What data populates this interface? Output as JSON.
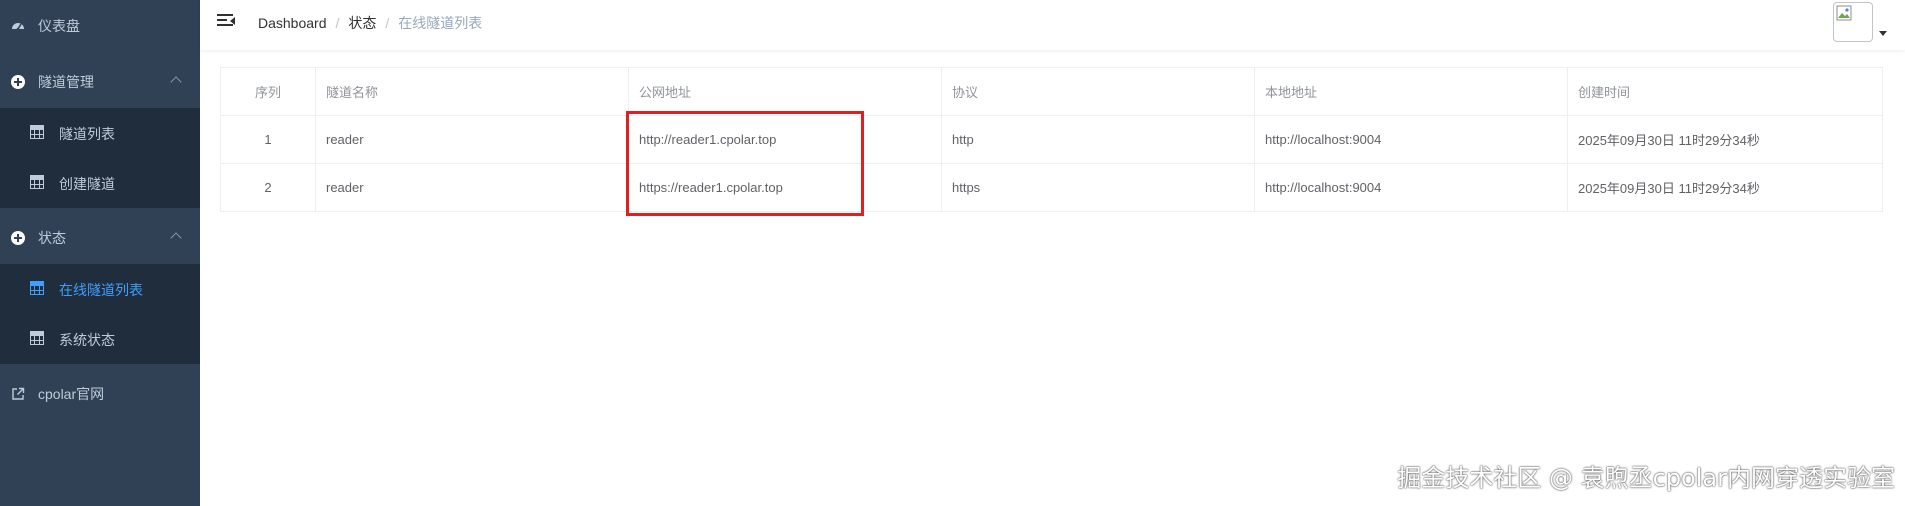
{
  "sidebar": {
    "dashboard": "仪表盘",
    "tunnel_mgmt": "隧道管理",
    "tunnel_list": "隧道列表",
    "create_tunnel": "创建隧道",
    "status": "状态",
    "online_tunnels": "在线隧道列表",
    "system_status": "系统状态",
    "cpolar_site": "cpolar官网"
  },
  "breadcrumb": {
    "home": "Dashboard",
    "sep1": "/",
    "level2": "状态",
    "sep2": "/",
    "current": "在线隧道列表"
  },
  "table": {
    "headers": [
      "序列",
      "隧道名称",
      "公网地址",
      "协议",
      "本地地址",
      "创建时间"
    ],
    "rows": [
      [
        "1",
        "reader",
        "http://reader1.cpolar.top",
        "http",
        "http://localhost:9004",
        "2025年09月30日 11时29分34秒"
      ],
      [
        "2",
        "reader",
        "https://reader1.cpolar.top",
        "https",
        "http://localhost:9004",
        "2025年09月30日 11时29分34秒"
      ]
    ]
  },
  "watermark": "掘金技术社区 @ 袁煦丞cpolar内网穿透实验室",
  "colors": {
    "sidebar_bg": "#304156",
    "submenu_bg": "#1f2d3d",
    "active": "#409eff",
    "highlight": "#e02020"
  },
  "icons": [
    "dashboard-icon",
    "plus-circle-icon",
    "grid-icon",
    "external-link-icon",
    "hamburger-icon",
    "avatar-image",
    "caret-down-icon"
  ]
}
